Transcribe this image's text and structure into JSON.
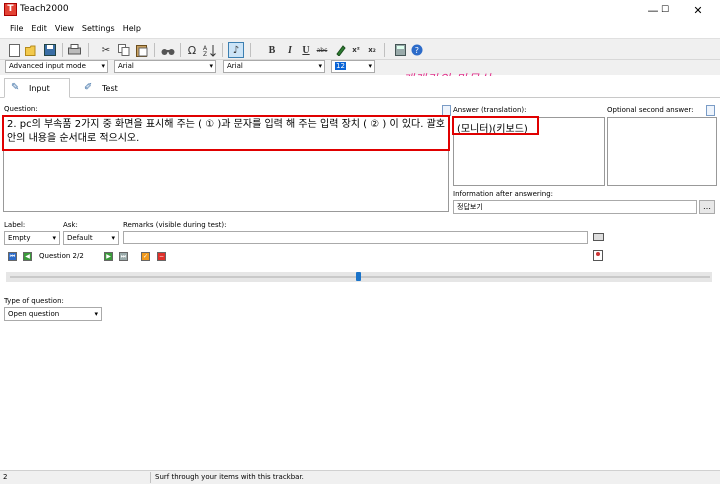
{
  "window": {
    "title": "Teach2000",
    "icon_letter": "T",
    "minimize": "—",
    "maximize": "☐",
    "close": "✕"
  },
  "menu": [
    "File",
    "Edit",
    "View",
    "Settings",
    "Help"
  ],
  "format_bar": {
    "input_mode": "Advanced input mode",
    "font1": "Arial",
    "font2": "Arial",
    "size": "12",
    "bold": "B",
    "italic": "I",
    "underline": "U",
    "strike": "abc",
    "superscript": "x²",
    "subscript": "x₂",
    "omega": "Ω"
  },
  "overlay_note": "개래라의 만물상",
  "tabs": [
    {
      "label": "Input"
    },
    {
      "label": "Test"
    }
  ],
  "labels": {
    "question": "Question:",
    "answer": "Answer (translation):",
    "second_answer": "Optional second answer:",
    "info_after": "Information after answering:",
    "label": "Label:",
    "ask": "Ask:",
    "remarks": "Remarks (visible during test):",
    "type_of_question": "Type of question:"
  },
  "question_text": "2. pc의 부속품 2가지 중 화면을 표시해 주는 ( ① )과 문자를 입력 해 주는 입력 장치 ( ② ) 이 있다. 괄호 안의 내용을 순서대로 적으시오.",
  "answer_text": "(모니터)(키보드)",
  "info_value": "정답보기",
  "selects": {
    "label": "Empty",
    "ask": "Default",
    "question_type": "Open question"
  },
  "nav": {
    "question_counter": "Question 2/2"
  },
  "slider": {
    "position_fraction": 0.5
  },
  "status": {
    "left": "2",
    "message": "Surf through your items with this trackbar."
  },
  "colors": {
    "highlight_red": "#e00000",
    "handwriting_pink": "#e0308a",
    "slider_blue": "#1a73c9"
  }
}
